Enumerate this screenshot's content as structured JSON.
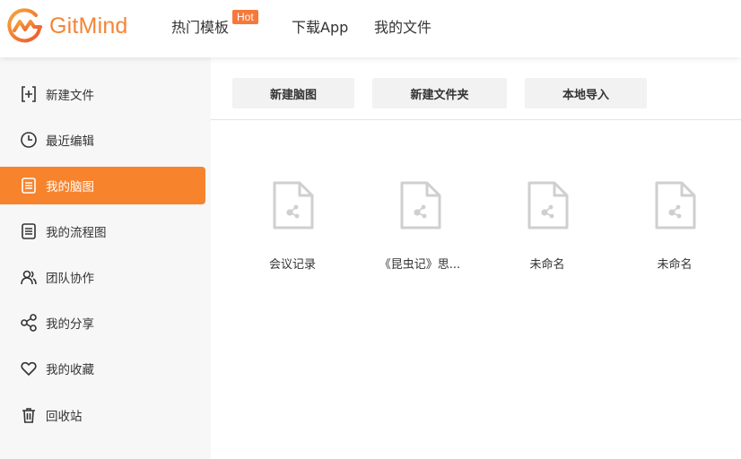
{
  "brand": {
    "name": "GitMind",
    "color": "#f48536"
  },
  "nav": {
    "templates": "热门模板",
    "hot": "Hot",
    "download": "下载App",
    "my_files": "我的文件"
  },
  "sidebar": {
    "items": [
      {
        "label": "新建文件",
        "icon": "new-file-icon"
      },
      {
        "label": "最近编辑",
        "icon": "clock-icon"
      },
      {
        "label": "我的脑图",
        "icon": "mindmap-icon",
        "active": true
      },
      {
        "label": "我的流程图",
        "icon": "flowchart-icon"
      },
      {
        "label": "团队协作",
        "icon": "team-icon"
      },
      {
        "label": "我的分享",
        "icon": "share-icon"
      },
      {
        "label": "我的收藏",
        "icon": "heart-icon"
      },
      {
        "label": "回收站",
        "icon": "trash-icon"
      }
    ],
    "active_color": "#f7832d"
  },
  "toolbar": {
    "new_mindmap": "新建脑图",
    "new_folder": "新建文件夹",
    "local_import": "本地导入"
  },
  "files": [
    {
      "name": "会议记录",
      "icon": "mindmap-file-icon"
    },
    {
      "name": "《昆虫记》思...",
      "icon": "mindmap-file-icon"
    },
    {
      "name": "未命名",
      "icon": "mindmap-file-icon"
    },
    {
      "name": "未命名",
      "icon": "mindmap-file-icon"
    }
  ]
}
